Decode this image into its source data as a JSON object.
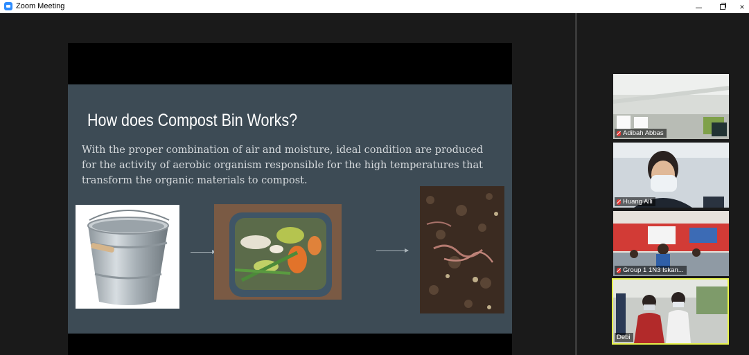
{
  "window": {
    "title": "Zoom Meeting",
    "minimize_glyph": "",
    "restore_glyph": "",
    "close_glyph": "×"
  },
  "slide": {
    "title": "How does Compost Bin Works?",
    "body": "With the proper combination of air and moisture, ideal condition are produced for the activity of aerobic organism responsible for the high temperatures that transform the organic materials to compost.",
    "images": [
      "metal-bucket",
      "food-scraps-bin",
      "compost-soil-with-worms"
    ],
    "background_color": "#3d4b55"
  },
  "participants": [
    {
      "name": "Adibah Abbas",
      "muted": true
    },
    {
      "name": "Huang Aili",
      "muted": true
    },
    {
      "name": "Group 1 1N3 Iskan...",
      "muted": true
    },
    {
      "name": "Debi",
      "muted": false,
      "active_speaker": true
    }
  ],
  "colors": {
    "zoom_blue": "#2d8cff",
    "active_speaker_border": "#e6f14a",
    "muted_red": "#e53935"
  }
}
